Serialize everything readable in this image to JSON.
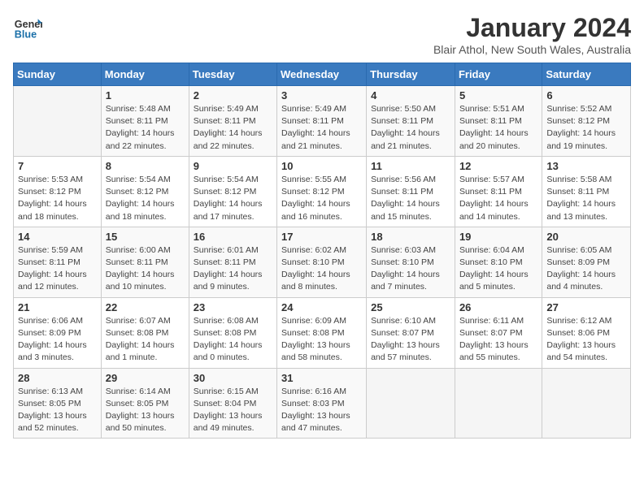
{
  "header": {
    "logo_line1": "General",
    "logo_line2": "Blue",
    "title": "January 2024",
    "location": "Blair Athol, New South Wales, Australia"
  },
  "days_of_week": [
    "Sunday",
    "Monday",
    "Tuesday",
    "Wednesday",
    "Thursday",
    "Friday",
    "Saturday"
  ],
  "weeks": [
    [
      {
        "day": "",
        "detail": ""
      },
      {
        "day": "1",
        "detail": "Sunrise: 5:48 AM\nSunset: 8:11 PM\nDaylight: 14 hours\nand 22 minutes."
      },
      {
        "day": "2",
        "detail": "Sunrise: 5:49 AM\nSunset: 8:11 PM\nDaylight: 14 hours\nand 22 minutes."
      },
      {
        "day": "3",
        "detail": "Sunrise: 5:49 AM\nSunset: 8:11 PM\nDaylight: 14 hours\nand 21 minutes."
      },
      {
        "day": "4",
        "detail": "Sunrise: 5:50 AM\nSunset: 8:11 PM\nDaylight: 14 hours\nand 21 minutes."
      },
      {
        "day": "5",
        "detail": "Sunrise: 5:51 AM\nSunset: 8:11 PM\nDaylight: 14 hours\nand 20 minutes."
      },
      {
        "day": "6",
        "detail": "Sunrise: 5:52 AM\nSunset: 8:12 PM\nDaylight: 14 hours\nand 19 minutes."
      }
    ],
    [
      {
        "day": "7",
        "detail": "Sunrise: 5:53 AM\nSunset: 8:12 PM\nDaylight: 14 hours\nand 18 minutes."
      },
      {
        "day": "8",
        "detail": "Sunrise: 5:54 AM\nSunset: 8:12 PM\nDaylight: 14 hours\nand 18 minutes."
      },
      {
        "day": "9",
        "detail": "Sunrise: 5:54 AM\nSunset: 8:12 PM\nDaylight: 14 hours\nand 17 minutes."
      },
      {
        "day": "10",
        "detail": "Sunrise: 5:55 AM\nSunset: 8:12 PM\nDaylight: 14 hours\nand 16 minutes."
      },
      {
        "day": "11",
        "detail": "Sunrise: 5:56 AM\nSunset: 8:11 PM\nDaylight: 14 hours\nand 15 minutes."
      },
      {
        "day": "12",
        "detail": "Sunrise: 5:57 AM\nSunset: 8:11 PM\nDaylight: 14 hours\nand 14 minutes."
      },
      {
        "day": "13",
        "detail": "Sunrise: 5:58 AM\nSunset: 8:11 PM\nDaylight: 14 hours\nand 13 minutes."
      }
    ],
    [
      {
        "day": "14",
        "detail": "Sunrise: 5:59 AM\nSunset: 8:11 PM\nDaylight: 14 hours\nand 12 minutes."
      },
      {
        "day": "15",
        "detail": "Sunrise: 6:00 AM\nSunset: 8:11 PM\nDaylight: 14 hours\nand 10 minutes."
      },
      {
        "day": "16",
        "detail": "Sunrise: 6:01 AM\nSunset: 8:11 PM\nDaylight: 14 hours\nand 9 minutes."
      },
      {
        "day": "17",
        "detail": "Sunrise: 6:02 AM\nSunset: 8:10 PM\nDaylight: 14 hours\nand 8 minutes."
      },
      {
        "day": "18",
        "detail": "Sunrise: 6:03 AM\nSunset: 8:10 PM\nDaylight: 14 hours\nand 7 minutes."
      },
      {
        "day": "19",
        "detail": "Sunrise: 6:04 AM\nSunset: 8:10 PM\nDaylight: 14 hours\nand 5 minutes."
      },
      {
        "day": "20",
        "detail": "Sunrise: 6:05 AM\nSunset: 8:09 PM\nDaylight: 14 hours\nand 4 minutes."
      }
    ],
    [
      {
        "day": "21",
        "detail": "Sunrise: 6:06 AM\nSunset: 8:09 PM\nDaylight: 14 hours\nand 3 minutes."
      },
      {
        "day": "22",
        "detail": "Sunrise: 6:07 AM\nSunset: 8:08 PM\nDaylight: 14 hours\nand 1 minute."
      },
      {
        "day": "23",
        "detail": "Sunrise: 6:08 AM\nSunset: 8:08 PM\nDaylight: 14 hours\nand 0 minutes."
      },
      {
        "day": "24",
        "detail": "Sunrise: 6:09 AM\nSunset: 8:08 PM\nDaylight: 13 hours\nand 58 minutes."
      },
      {
        "day": "25",
        "detail": "Sunrise: 6:10 AM\nSunset: 8:07 PM\nDaylight: 13 hours\nand 57 minutes."
      },
      {
        "day": "26",
        "detail": "Sunrise: 6:11 AM\nSunset: 8:07 PM\nDaylight: 13 hours\nand 55 minutes."
      },
      {
        "day": "27",
        "detail": "Sunrise: 6:12 AM\nSunset: 8:06 PM\nDaylight: 13 hours\nand 54 minutes."
      }
    ],
    [
      {
        "day": "28",
        "detail": "Sunrise: 6:13 AM\nSunset: 8:05 PM\nDaylight: 13 hours\nand 52 minutes."
      },
      {
        "day": "29",
        "detail": "Sunrise: 6:14 AM\nSunset: 8:05 PM\nDaylight: 13 hours\nand 50 minutes."
      },
      {
        "day": "30",
        "detail": "Sunrise: 6:15 AM\nSunset: 8:04 PM\nDaylight: 13 hours\nand 49 minutes."
      },
      {
        "day": "31",
        "detail": "Sunrise: 6:16 AM\nSunset: 8:03 PM\nDaylight: 13 hours\nand 47 minutes."
      },
      {
        "day": "",
        "detail": ""
      },
      {
        "day": "",
        "detail": ""
      },
      {
        "day": "",
        "detail": ""
      }
    ]
  ]
}
